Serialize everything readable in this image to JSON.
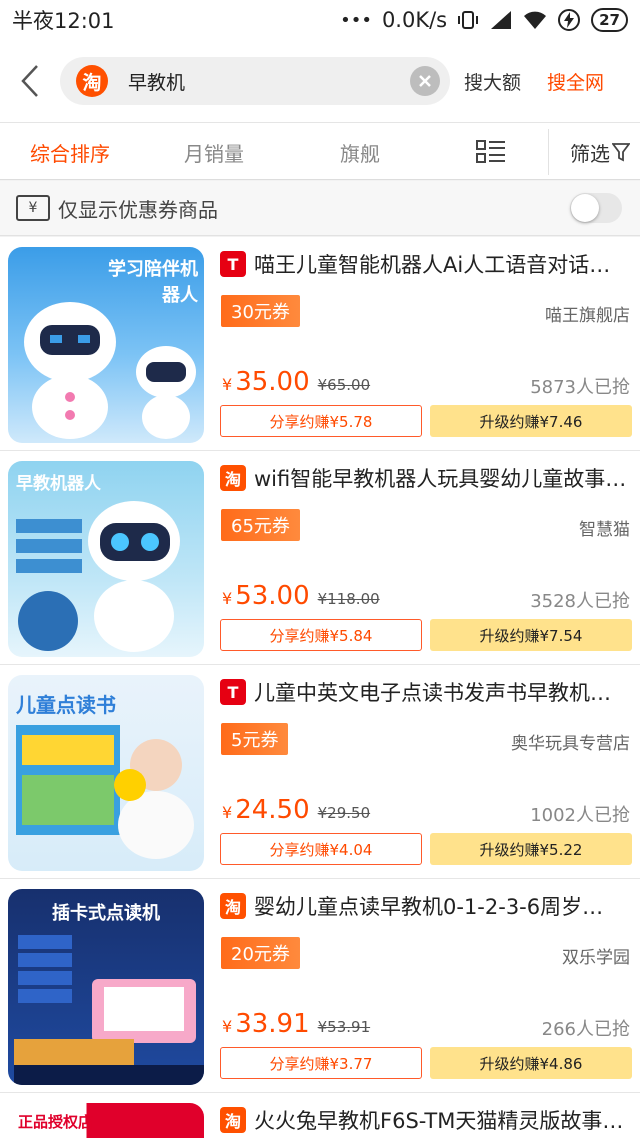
{
  "status_bar": {
    "time": "半夜12:01",
    "dots": "•••",
    "network_speed": "0.0K/s",
    "battery": "27"
  },
  "header": {
    "search_value": "早教机",
    "tao_badge": "淘",
    "search_big": "搜大额",
    "search_all": "搜全网",
    "accent_color": "#ff4a00"
  },
  "sort_tabs": [
    {
      "label": "综合排序",
      "active": true
    },
    {
      "label": "月销量",
      "active": false
    },
    {
      "label": "旗舰",
      "active": false
    }
  ],
  "filter_label": "筛选",
  "coupon_toggle": {
    "label": "仅显示优惠券商品",
    "icon_text": "¥",
    "enabled": false
  },
  "products": [
    {
      "source": "tmall",
      "source_glyph": "T",
      "title": "喵王儿童智能机器人Ai人工语音对话…",
      "coupon": "30元券",
      "shop": "喵王旗舰店",
      "yen": "¥",
      "price": "35.00",
      "original_price": "¥65.00",
      "sold": "5873人已抢",
      "share": "分享约赚¥5.78",
      "upgrade": "升级约赚¥7.46",
      "thumb_caption": "学习陪伴机器人"
    },
    {
      "source": "taobao",
      "source_glyph": "淘",
      "title": "wifi智能早教机器人玩具婴幼儿童故事…",
      "coupon": "65元券",
      "shop": "智慧猫",
      "yen": "¥",
      "price": "53.00",
      "original_price": "¥118.00",
      "sold": "3528人已抢",
      "share": "分享约赚¥5.84",
      "upgrade": "升级约赚¥7.54",
      "thumb_caption": "早教机器人"
    },
    {
      "source": "tmall",
      "source_glyph": "T",
      "title": "儿童中英文电子点读书发声书早教机…",
      "coupon": "5元券",
      "shop": "奥华玩具专营店",
      "yen": "¥",
      "price": "24.50",
      "original_price": "¥29.50",
      "sold": "1002人已抢",
      "share": "分享约赚¥4.04",
      "upgrade": "升级约赚¥5.22",
      "thumb_caption": "儿童点读书"
    },
    {
      "source": "taobao",
      "source_glyph": "淘",
      "title": "婴幼儿童点读早教机0-1-2-3-6周岁…",
      "coupon": "20元券",
      "shop": "双乐学园",
      "yen": "¥",
      "price": "33.91",
      "original_price": "¥53.91",
      "sold": "266人已抢",
      "share": "分享约赚¥3.77",
      "upgrade": "升级约赚¥4.86",
      "thumb_caption": "插卡式点读机"
    },
    {
      "source": "taobao",
      "source_glyph": "淘",
      "title": "火火兔早教机F6S-TM天猫精灵版故事…",
      "thumb_caption": "正品授权店"
    }
  ]
}
